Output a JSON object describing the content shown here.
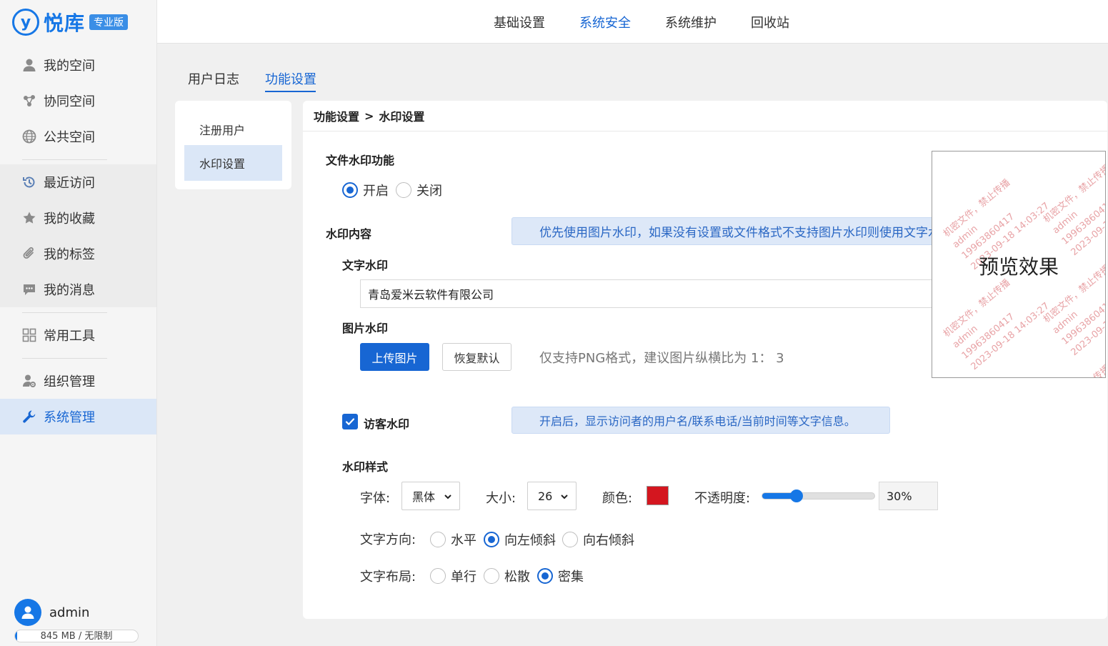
{
  "app": {
    "logo_mark": "y",
    "name": "悦库",
    "edition": "专业版"
  },
  "sidebar": {
    "items": [
      {
        "label": "我的空间",
        "icon": "user-icon"
      },
      {
        "label": "协同空间",
        "icon": "share-icon"
      },
      {
        "label": "公共空间",
        "icon": "globe-icon"
      },
      {
        "label": "最近访问",
        "icon": "history-icon"
      },
      {
        "label": "我的收藏",
        "icon": "star-icon"
      },
      {
        "label": "我的标签",
        "icon": "paperclip-icon"
      },
      {
        "label": "我的消息",
        "icon": "message-icon"
      },
      {
        "label": "常用工具",
        "icon": "grid-icon"
      },
      {
        "label": "组织管理",
        "icon": "org-user-icon"
      },
      {
        "label": "系统管理",
        "icon": "wrench-icon",
        "active": true
      }
    ],
    "user": {
      "name": "admin",
      "quota_text": "845 MB / 无限制",
      "quota_used_fraction": 0.02
    }
  },
  "top_tabs": [
    {
      "label": "基础设置"
    },
    {
      "label": "系统安全",
      "active": true
    },
    {
      "label": "系统维护"
    },
    {
      "label": "回收站"
    }
  ],
  "sub_tabs": [
    {
      "label": "用户日志"
    },
    {
      "label": "功能设置",
      "active": true
    }
  ],
  "inner_nav": [
    {
      "label": "注册用户"
    },
    {
      "label": "水印设置",
      "active": true
    }
  ],
  "breadcrumb": {
    "parent": "功能设置",
    "separator": ">",
    "current": "水印设置"
  },
  "watermark": {
    "feature_label": "文件水印功能",
    "enable_options": [
      {
        "label": "开启",
        "selected": true
      },
      {
        "label": "关闭",
        "selected": false
      }
    ],
    "content_label": "水印内容",
    "content_hint": "优先使用图片水印，如果没有设置或文件格式不支持图片水印则使用文字水印",
    "text_label": "文字水印",
    "text_value": "青岛爱米云软件有限公司",
    "image_label": "图片水印",
    "upload_button": "上传图片",
    "reset_button": "恢复默认",
    "image_hint": "仅支持PNG格式，建议图片纵横比为 1： 3",
    "visitor_label": "访客水印",
    "visitor_checked": true,
    "visitor_hint": "开启后，显示访问者的用户名/联系电话/当前时间等文字信息。",
    "style_label": "水印样式",
    "font_label": "字体:",
    "font_value": "黑体",
    "size_label": "大小:",
    "size_value": "26",
    "color_label": "颜色:",
    "color_value": "#d4161f",
    "opacity_label": "不透明度:",
    "opacity_value": "30%",
    "opacity_fraction": 0.3,
    "direction_label": "文字方向:",
    "direction_options": [
      {
        "label": "水平",
        "selected": false
      },
      {
        "label": "向左倾斜",
        "selected": true
      },
      {
        "label": "向右倾斜",
        "selected": false
      }
    ],
    "layout_label": "文字布局:",
    "layout_options": [
      {
        "label": "单行",
        "selected": false
      },
      {
        "label": "松散",
        "selected": false
      },
      {
        "label": "密集",
        "selected": true
      }
    ],
    "preview": {
      "title": "预览效果",
      "lines": [
        "机密文件，禁止传播",
        "admin",
        "19963860417",
        "2023-09-18 14:03:27"
      ]
    }
  },
  "colors": {
    "accent": "#1766d3",
    "watermark_text": "#e8a3a6"
  }
}
